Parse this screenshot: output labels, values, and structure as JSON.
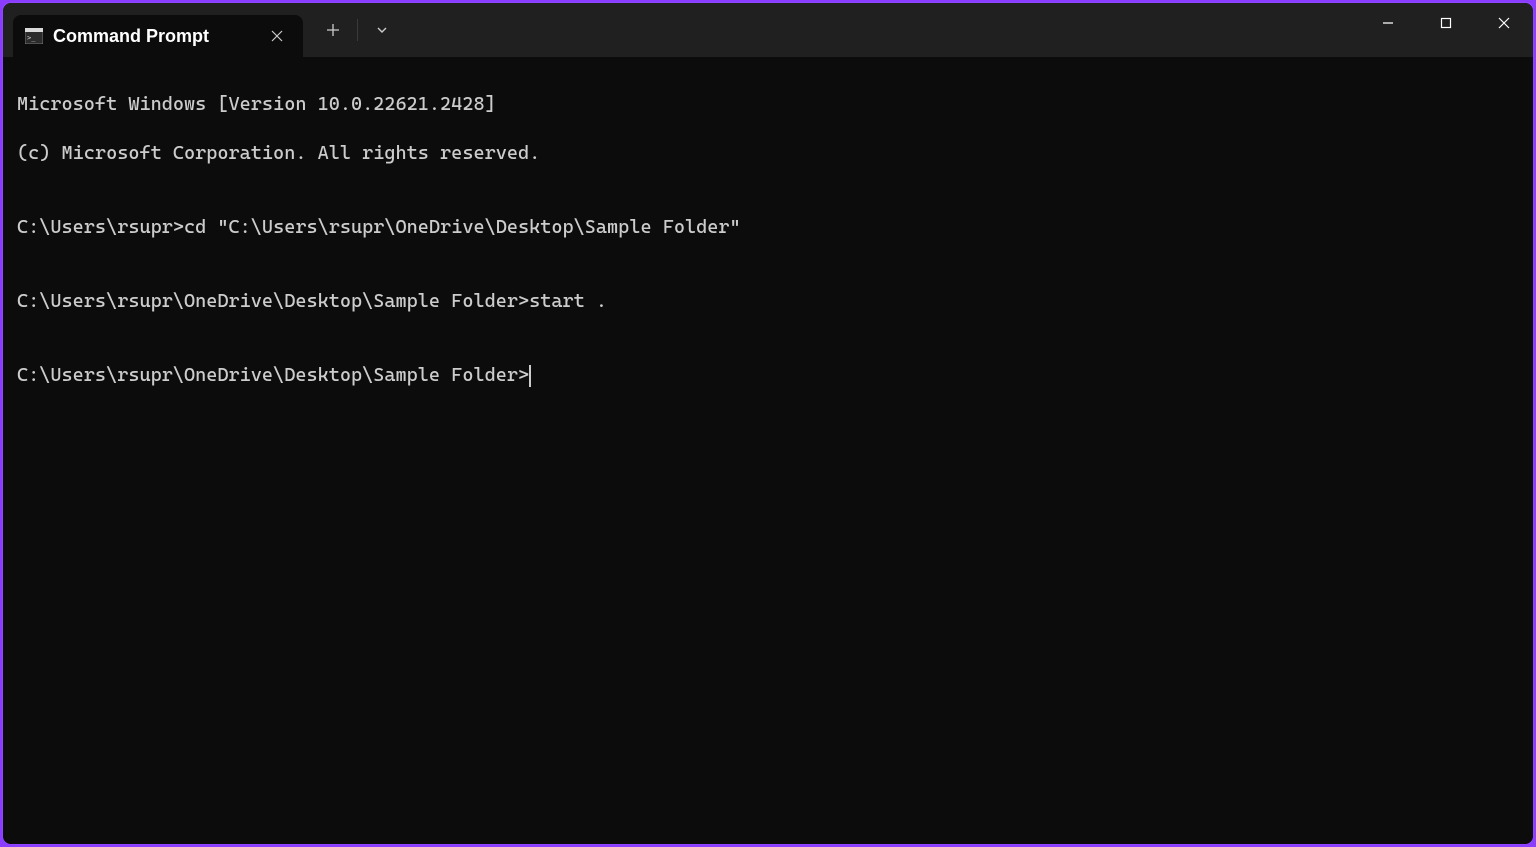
{
  "tab": {
    "title": "Command Prompt"
  },
  "terminal": {
    "line1": "Microsoft Windows [Version 10.0.22621.2428]",
    "line2": "(c) Microsoft Corporation. All rights reserved.",
    "blank1": "",
    "prompt1": "C:\\Users\\rsupr>",
    "cmd1": "cd \"C:\\Users\\rsupr\\OneDrive\\Desktop\\Sample Folder\"",
    "blank2": "",
    "prompt2": "C:\\Users\\rsupr\\OneDrive\\Desktop\\Sample Folder>",
    "cmd2": "start .",
    "blank3": "",
    "prompt3": "C:\\Users\\rsupr\\OneDrive\\Desktop\\Sample Folder>"
  }
}
